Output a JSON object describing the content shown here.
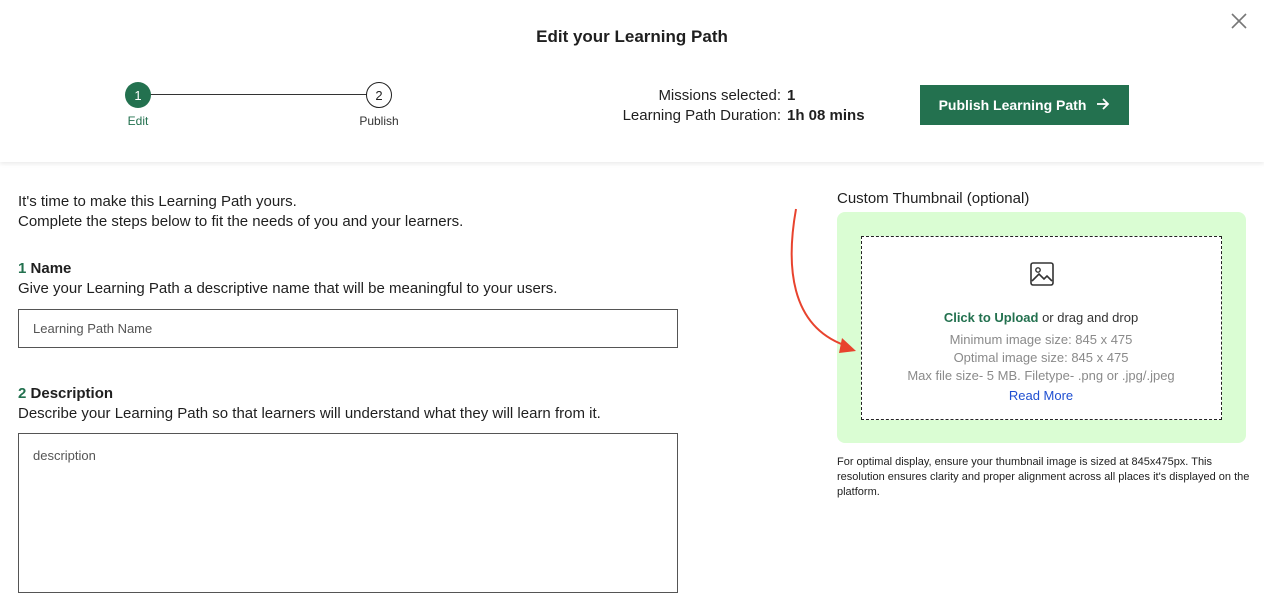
{
  "header": {
    "title": "Edit your Learning Path",
    "close_icon": "close-icon"
  },
  "stepper": {
    "steps": [
      {
        "number": "1",
        "label": "Edit",
        "active": true
      },
      {
        "number": "2",
        "label": "Publish",
        "active": false
      }
    ]
  },
  "stats": {
    "missions_label": "Missions selected:",
    "missions_value": "1",
    "duration_label": "Learning Path Duration:",
    "duration_value": "1h 08 mins"
  },
  "publish_button": {
    "label": "Publish Learning Path",
    "icon": "arrow-right-icon"
  },
  "intro": {
    "line1": "It's time to make this Learning Path yours.",
    "line2": "Complete the steps below to fit the needs of you and your learners."
  },
  "name_section": {
    "number": "1",
    "title": "Name",
    "description": "Give your Learning Path a descriptive name that will be meaningful to your users.",
    "placeholder": "Learning Path Name"
  },
  "description_section": {
    "number": "2",
    "title": "Description",
    "description": "Describe your Learning Path so that learners will understand what they will learn from it.",
    "placeholder": "description"
  },
  "thumbnail": {
    "label": "Custom Thumbnail (optional)",
    "click_upload": "Click to Upload",
    "drag_drop": "or drag and drop",
    "min_size": "Minimum image size: 845 x 475",
    "optimal_size": "Optimal image size: 845 x 475",
    "max_size": "Max file size- 5 MB. Filetype- .png or .jpg/.jpeg",
    "read_more": "Read More",
    "footnote": "For optimal display, ensure your thumbnail image is sized at 845x475px. This resolution ensures clarity and proper alignment across all places it's displayed on the platform."
  },
  "colors": {
    "accent": "#23714f",
    "upload_bg": "#dafdd3",
    "link": "#1f4fd1",
    "annotation_arrow": "#e8432e"
  }
}
